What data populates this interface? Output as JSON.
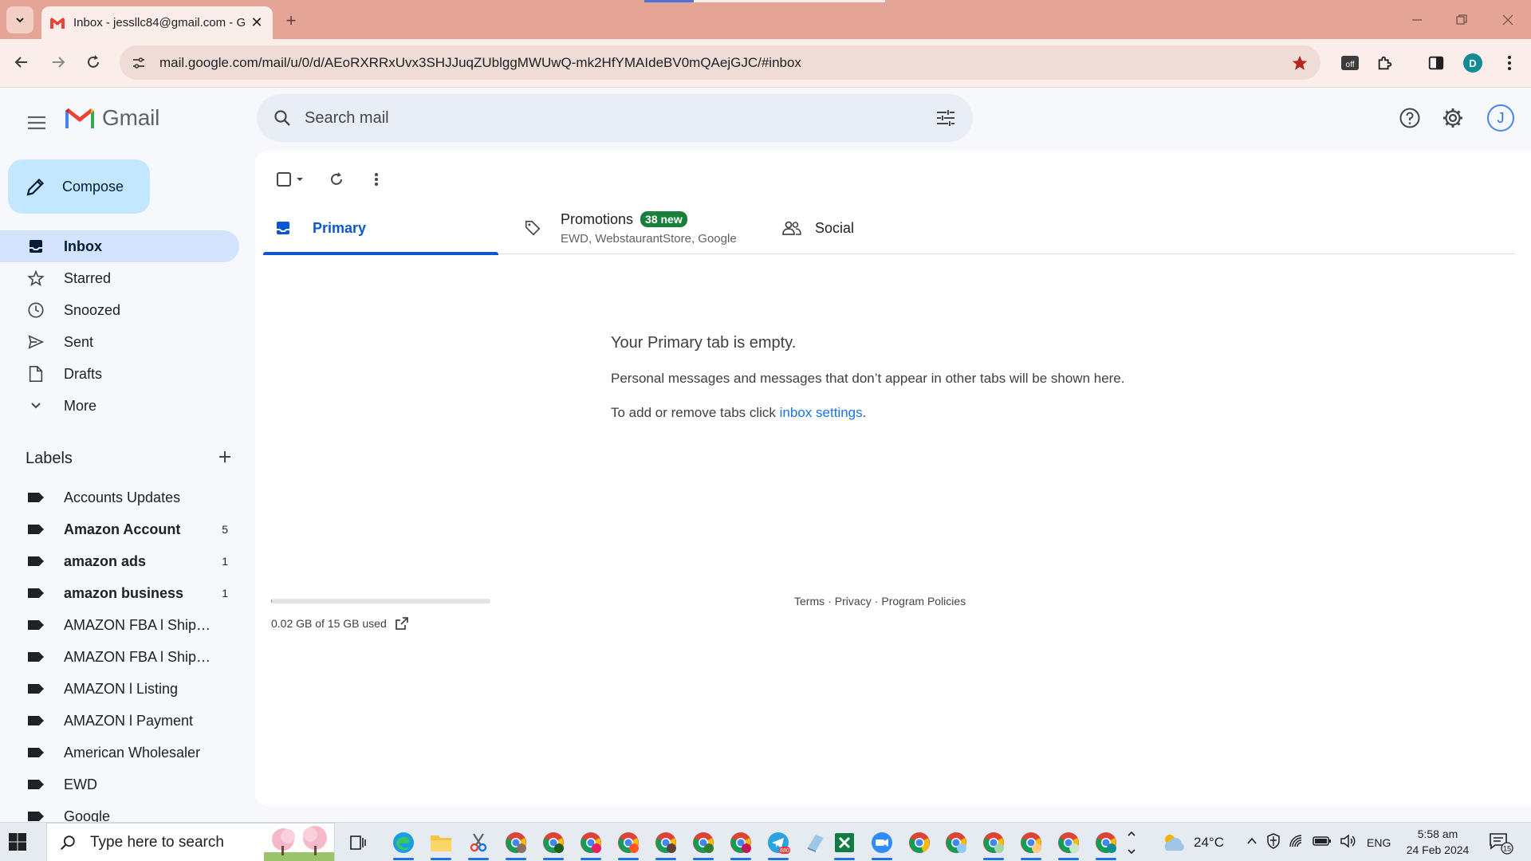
{
  "browser": {
    "tab_title": "Inbox - jessllc84@gmail.com - G",
    "url": "mail.google.com/mail/u/0/d/AEoRXRRxUvx3SHJJuqZUblggMWUwQ-mk2HfYMAIdeBV0mQAejGJC/#inbox",
    "new_tab_symbol": "+",
    "profile_initial": "D",
    "extension_badge": "off",
    "accent_color": "#e4a596"
  },
  "gmail": {
    "logo_text": "Gmail",
    "search_placeholder": "Search mail",
    "account_initial": "J",
    "compose_label": "Compose"
  },
  "nav": {
    "items": [
      {
        "label": "Inbox",
        "icon": "inbox-icon",
        "active": true
      },
      {
        "label": "Starred",
        "icon": "star-icon"
      },
      {
        "label": "Snoozed",
        "icon": "clock-icon"
      },
      {
        "label": "Sent",
        "icon": "send-icon"
      },
      {
        "label": "Drafts",
        "icon": "draft-icon"
      },
      {
        "label": "More",
        "icon": "chevron-down-icon"
      }
    ]
  },
  "labels": {
    "title": "Labels",
    "items": [
      {
        "name": "Accounts Updates",
        "count": "",
        "bold": false
      },
      {
        "name": "Amazon Account",
        "count": "5",
        "bold": true
      },
      {
        "name": "amazon ads",
        "count": "1",
        "bold": true
      },
      {
        "name": "amazon business",
        "count": "1",
        "bold": true
      },
      {
        "name": "AMAZON FBA l Shipmen...",
        "count": "",
        "bold": false
      },
      {
        "name": "AMAZON FBA l Shipped ...",
        "count": "",
        "bold": false
      },
      {
        "name": "AMAZON l Listing",
        "count": "",
        "bold": false
      },
      {
        "name": "AMAZON l Payment",
        "count": "",
        "bold": false
      },
      {
        "name": "American Wholesaler",
        "count": "",
        "bold": false
      },
      {
        "name": "EWD",
        "count": "",
        "bold": false
      },
      {
        "name": "Google",
        "count": "",
        "bold": false
      }
    ]
  },
  "tabs": {
    "primary": "Primary",
    "promotions": "Promotions",
    "promotions_badge": "38 new",
    "promotions_senders": "EWD, WebstaurantStore, Google",
    "social": "Social"
  },
  "empty_state": {
    "title": "Your Primary tab is empty.",
    "line1": "Personal messages and messages that don’t appear in other tabs will be shown here.",
    "line2_prefix": "To add or remove tabs click ",
    "line2_link": "inbox settings",
    "line2_suffix": "."
  },
  "storage": {
    "text": "0.02 GB of 15 GB used",
    "used_fraction": 0.0013
  },
  "footer": {
    "terms": "Terms",
    "privacy": "Privacy",
    "policies": "Program Policies",
    "separator": "·"
  },
  "taskbar": {
    "search_placeholder": "Type here to search",
    "weather": "24°C",
    "language": "ENG",
    "time": "5:58 am",
    "date": "24 Feb 2024",
    "notifications": "15",
    "telegram_badge": "680"
  }
}
